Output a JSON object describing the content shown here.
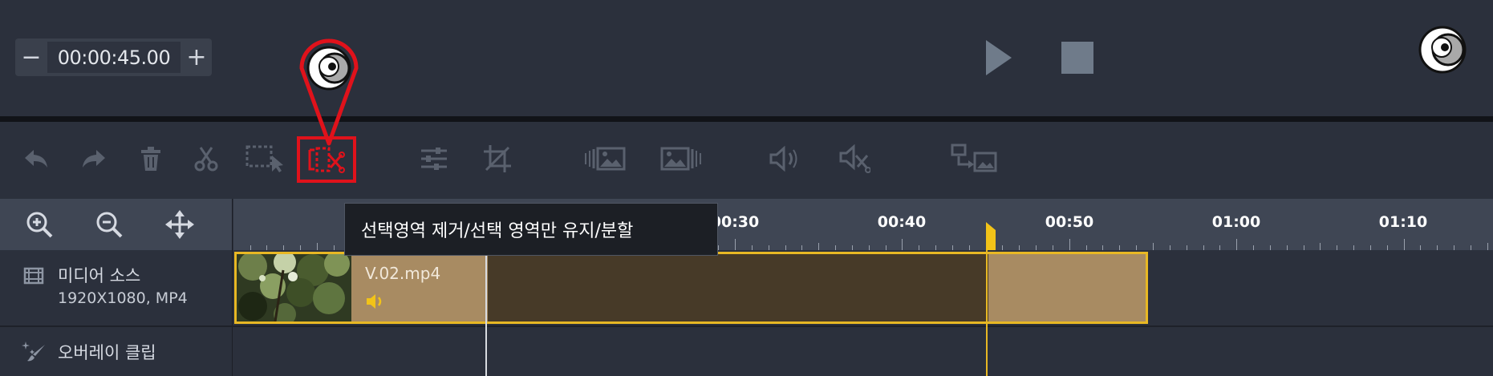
{
  "time_control": {
    "minus_label": "−",
    "value": "00:00:45.00",
    "plus_label": "+"
  },
  "playback": {
    "play_icon": "play-icon",
    "stop_icon": "stop-icon"
  },
  "toolbar": {
    "items": [
      {
        "name": "undo",
        "icon": "undo-icon"
      },
      {
        "name": "redo",
        "icon": "redo-icon"
      },
      {
        "name": "delete",
        "icon": "trash-icon"
      },
      {
        "name": "cut",
        "icon": "scissors-icon"
      },
      {
        "name": "select-range",
        "icon": "select-range-icon"
      },
      {
        "name": "remove-selected-split",
        "icon": "split-clip-icon",
        "highlighted": true
      },
      {
        "name": "adjust",
        "icon": "sliders-icon"
      },
      {
        "name": "crop",
        "icon": "crop-icon"
      },
      {
        "name": "fade-in",
        "icon": "image-fade-in-icon"
      },
      {
        "name": "fade-out",
        "icon": "image-fade-out-icon"
      },
      {
        "name": "audio-volume",
        "icon": "speaker-icon"
      },
      {
        "name": "audio-split",
        "icon": "speaker-scissors-icon"
      },
      {
        "name": "replace-media",
        "icon": "replace-media-icon"
      }
    ]
  },
  "tooltip": {
    "text": "선택영역 제거/선택 영역만 유지/분할"
  },
  "timeline": {
    "controls": [
      "zoom-in-icon",
      "zoom-out-icon",
      "move-icon"
    ],
    "ruler_labels": [
      "00:30",
      "00:40",
      "00:50",
      "01:00",
      "01:10"
    ],
    "tracks": [
      {
        "name": "미디어 소스",
        "sub": "1920X1080, MP4",
        "icon": "film-icon"
      },
      {
        "name": "오버레이 클립",
        "icon": "sparkle-brush-icon"
      }
    ],
    "clip": {
      "name": "V.02.mp4",
      "audio_icon": "speaker-icon"
    }
  },
  "colors": {
    "background": "#2b303c",
    "clip_fill": "#a88b62",
    "clip_selected_region": "#473a28",
    "clip_border": "#e8b824",
    "highlight_red": "#e0121b",
    "toolbar_icon": "#5a616e"
  }
}
